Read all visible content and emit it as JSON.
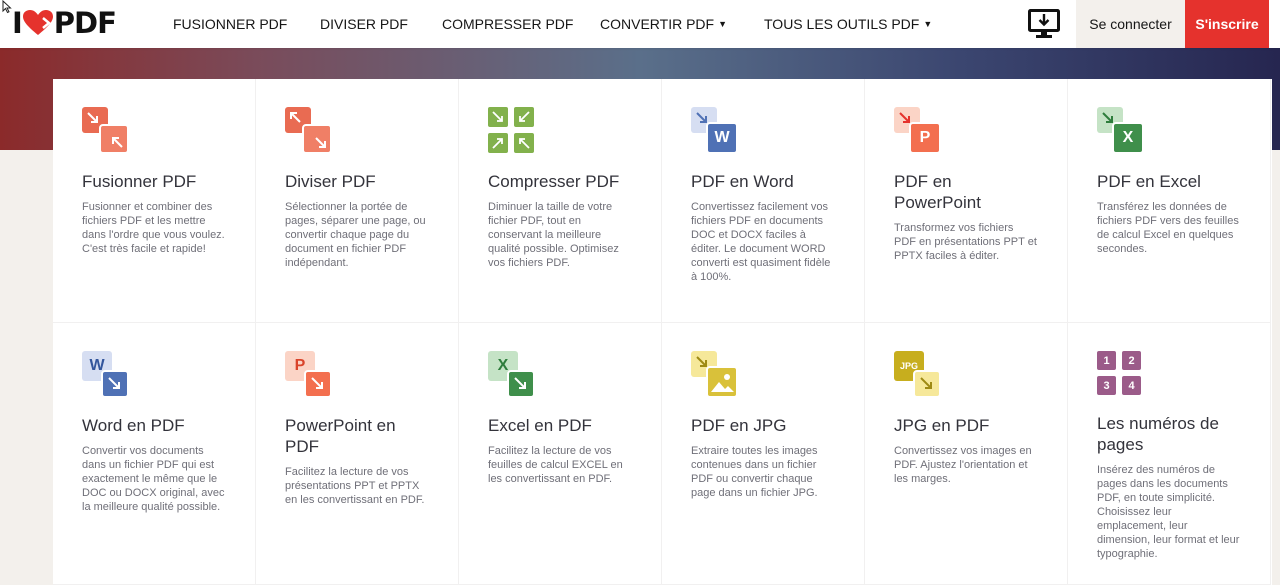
{
  "header": {
    "logo_left": "I",
    "logo_right": "PDF",
    "nav": [
      {
        "label": "FUSIONNER PDF"
      },
      {
        "label": "DIVISER PDF"
      },
      {
        "label": "COMPRESSER PDF"
      },
      {
        "label": "CONVERTIR PDF",
        "caret": "▼"
      },
      {
        "label": "TOUS LES OUTILS PDF",
        "caret": "▼"
      }
    ],
    "login": "Se connecter",
    "signup": "S'inscrire"
  },
  "colors": {
    "brand_red": "#e5322d",
    "word_blue": "#4f71b5",
    "excel_green": "#2e7d3c",
    "ppt_orange": "#f36f4f",
    "jpg_yellow": "#c7ae1e",
    "pages_purple": "#9b5b89",
    "merge_orange": "#e96b52",
    "compress_green": "#82b14c"
  },
  "tools": [
    {
      "icon": "merge-icon",
      "title": "Fusionner PDF",
      "desc": "Fusionner et combiner des fichiers PDF et les mettre dans l'ordre que vous voulez. C'est très facile et rapide!"
    },
    {
      "icon": "split-icon",
      "title": "Diviser PDF",
      "desc": "Sélectionner la portée de pages, séparer une page, ou convertir chaque page du document en fichier PDF indépendant."
    },
    {
      "icon": "compress-icon",
      "title": "Compresser PDF",
      "desc": "Diminuer la taille de votre fichier PDF, tout en conservant la meilleure qualité possible. Optimisez vos fichiers PDF."
    },
    {
      "icon": "pdf-to-word-icon",
      "letter": "W",
      "title": "PDF en Word",
      "desc": "Convertissez facilement vos fichiers PDF en documents DOC et DOCX faciles à éditer. Le document WORD converti est quasiment fidèle à 100%."
    },
    {
      "icon": "pdf-to-powerpoint-icon",
      "letter": "P",
      "title": "PDF en PowerPoint",
      "desc": "Transformez vos fichiers PDF en présentations PPT et PPTX faciles à éditer."
    },
    {
      "icon": "pdf-to-excel-icon",
      "letter": "X",
      "title": "PDF en Excel",
      "desc": "Transférez les données de fichiers PDF vers des feuilles de calcul Excel en quelques secondes."
    },
    {
      "icon": "word-to-pdf-icon",
      "letter": "W",
      "title": "Word en PDF",
      "desc": "Convertir vos documents dans un fichier PDF qui est exactement le même que le DOC ou DOCX original, avec la meilleure qualité possible."
    },
    {
      "icon": "powerpoint-to-pdf-icon",
      "letter": "P",
      "title": "PowerPoint en PDF",
      "desc": "Facilitez la lecture de vos présentations PPT et PPTX en les convertissant en PDF."
    },
    {
      "icon": "excel-to-pdf-icon",
      "letter": "X",
      "title": "Excel en PDF",
      "desc": "Facilitez la lecture de vos feuilles de calcul EXCEL en les convertissant en PDF."
    },
    {
      "icon": "pdf-to-jpg-icon",
      "title": "PDF en JPG",
      "desc": "Extraire toutes les images contenues dans un fichier PDF ou convertir chaque page dans un fichier JPG."
    },
    {
      "icon": "jpg-to-pdf-icon",
      "letter": "JPG",
      "title": "JPG en PDF",
      "desc": "Convertissez vos images en PDF. Ajustez l'orientation et les marges."
    },
    {
      "icon": "page-numbers-icon",
      "digits": [
        "1",
        "2",
        "3",
        "4"
      ],
      "title": "Les numéros de pages",
      "desc": "Insérez des numéros de pages dans les documents PDF, en toute simplicité. Choisissez leur emplacement, leur dimension, leur format et leur typographie."
    }
  ]
}
